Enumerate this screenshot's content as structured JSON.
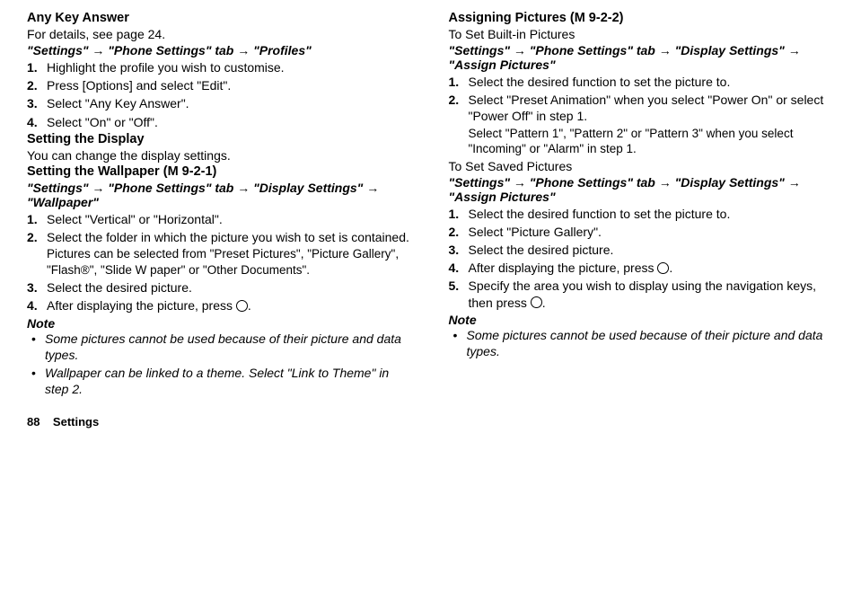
{
  "left": {
    "anyKeyAnswer": {
      "heading": "Any Key Answer",
      "details": "For details, see page 24.",
      "navPath": "\"Settings\" → \"Phone Settings\" tab → \"Profiles\"",
      "steps": [
        "Highlight the profile you wish to customise.",
        "Press [Options] and select \"Edit\".",
        "Select \"Any Key Answer\".",
        "Select \"On\" or \"Off\"."
      ]
    },
    "settingDisplay": {
      "heading": "Setting the Display",
      "desc": "You can change the display settings."
    },
    "settingWallpaper": {
      "heading": "Setting the Wallpaper ",
      "menuCode": "(M 9-2-1)",
      "navPath": "\"Settings\" → \"Phone Settings\" tab → \"Display Settings\" → \"Wallpaper\"",
      "steps": [
        {
          "text": "Select \"Vertical\" or \"Horizontal\"."
        },
        {
          "text": "Select the folder in which the picture you wish to set is contained.",
          "sub": "Pictures can be selected from \"Preset Pictures\", \"Picture Gallery\", \"Flash®\", \"Slide W paper\" or \"Other Documents\"."
        },
        {
          "text": "Select the desired picture."
        },
        {
          "text": "After displaying the picture, press ",
          "icon": true,
          "after": "."
        }
      ],
      "noteLabel": "Note",
      "notes": [
        "Some pictures cannot be used because of their picture and data types.",
        "Wallpaper can be linked to a theme. Select \"Link to Theme\" in step 2."
      ]
    }
  },
  "right": {
    "assignPictures": {
      "heading": "Assigning Pictures ",
      "menuCode": "(M 9-2-2)",
      "builtIn": {
        "subHeading": "To Set Built-in Pictures",
        "navPath": "\"Settings\" → \"Phone Settings\" tab → \"Display Settings\" → \"Assign Pictures\"",
        "steps": [
          {
            "text": "Select the desired function to set the picture to."
          },
          {
            "text": "Select \"Preset Animation\" when you select \"Power On\" or select \"Power Off\" in step 1.",
            "sub": "Select \"Pattern 1\", \"Pattern 2\" or \"Pattern 3\" when you select \"Incoming\" or \"Alarm\" in step 1."
          }
        ]
      },
      "saved": {
        "subHeading": "To Set Saved Pictures",
        "navPath": "\"Settings\" → \"Phone Settings\" tab → \"Display Settings\" → \"Assign Pictures\"",
        "steps": [
          {
            "text": "Select the desired function to set the picture to."
          },
          {
            "text": "Select \"Picture Gallery\"."
          },
          {
            "text": "Select the desired picture."
          },
          {
            "text": "After displaying the picture, press ",
            "icon": true,
            "after": "."
          },
          {
            "text": "Specify the area you wish to display using the navigation keys, then press ",
            "icon": true,
            "after": "."
          }
        ],
        "noteLabel": "Note",
        "notes": [
          "Some pictures cannot be used because of their picture and data types."
        ]
      }
    }
  },
  "footer": {
    "pageNum": "88",
    "section": "Settings"
  }
}
